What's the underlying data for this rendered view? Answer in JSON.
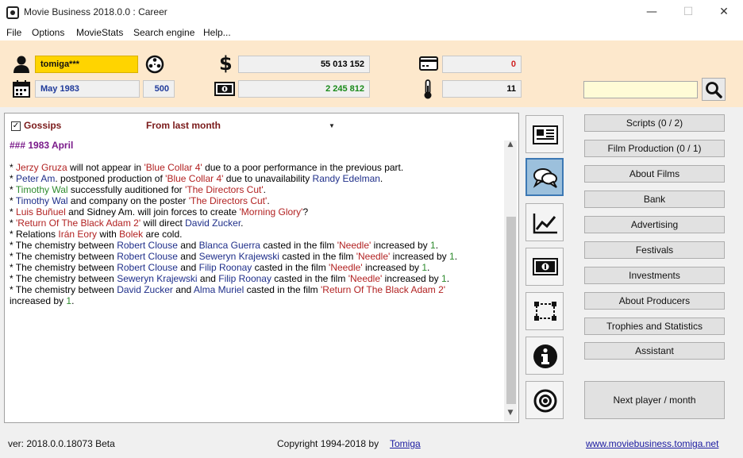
{
  "window": {
    "title": "Movie Business 2018.0.0 : Career",
    "minimize": "—",
    "maximize": "☐",
    "close": "✕"
  },
  "menu": [
    "File",
    "Options",
    "MovieStats",
    "Search engine",
    "Help..."
  ],
  "player": {
    "name": "tomiga***",
    "date": "May 1983",
    "date_number": "500",
    "money": "55 013 152",
    "cash": "2 245 812",
    "debt": "0",
    "temperature": "11",
    "search_value": ""
  },
  "colors": {
    "accent_yellow": "#ffd400",
    "panel_bg": "#fde8cc",
    "debt_red": "#d02020",
    "cash_green": "#1a8a1a"
  },
  "icons": {
    "user": "user-icon",
    "calendar": "calendar-icon",
    "film_reel": "film-reel-icon",
    "dollar": "dollar-icon",
    "banknote": "banknote-icon",
    "credit_card": "credit-card-icon",
    "thermometer": "thermometer-icon",
    "search": "search-icon"
  },
  "content": {
    "gossips_label": "Gossips",
    "period": "From last month",
    "month_heading": "### 1983 April",
    "news": [
      [
        {
          "t": "* "
        },
        {
          "t": "Jerzy Gruza",
          "c": "p"
        },
        {
          "t": " will not appear in "
        },
        {
          "t": "'Blue Collar 4'",
          "c": "f"
        },
        {
          "t": " due to a poor performance in the previous part."
        }
      ],
      [
        {
          "t": "* "
        },
        {
          "t": "Peter Am",
          "c": "n"
        },
        {
          "t": ". postponed production of "
        },
        {
          "t": "'Blue Collar 4'",
          "c": "f"
        },
        {
          "t": " due to unavailability "
        },
        {
          "t": "Randy Edelman",
          "c": "n"
        },
        {
          "t": "."
        }
      ],
      [
        {
          "t": "* "
        },
        {
          "t": "Timothy Wal",
          "c": "g"
        },
        {
          "t": " successfully auditioned for "
        },
        {
          "t": "'The Directors Cut'",
          "c": "f"
        },
        {
          "t": "."
        }
      ],
      [
        {
          "t": "* "
        },
        {
          "t": "Timothy Wal",
          "c": "n"
        },
        {
          "t": " and company on the poster "
        },
        {
          "t": "'The Directors Cut'",
          "c": "f"
        },
        {
          "t": "."
        }
      ],
      [
        {
          "t": "* "
        },
        {
          "t": "Luis Buñuel",
          "c": "p"
        },
        {
          "t": " and Sidney Am. will join forces to create "
        },
        {
          "t": "'Morning Glory'",
          "c": "f"
        },
        {
          "t": "?"
        }
      ],
      [
        {
          "t": "* "
        },
        {
          "t": "'Return Of The Black Adam 2'",
          "c": "f"
        },
        {
          "t": " will direct "
        },
        {
          "t": "David Zucker",
          "c": "n"
        },
        {
          "t": "."
        }
      ],
      [
        {
          "t": "* Relations "
        },
        {
          "t": "Irán Eory",
          "c": "p"
        },
        {
          "t": " with "
        },
        {
          "t": "Bolek",
          "c": "p"
        },
        {
          "t": " are cold."
        }
      ],
      [
        {
          "t": "* The chemistry between "
        },
        {
          "t": "Robert Clouse",
          "c": "n"
        },
        {
          "t": " and "
        },
        {
          "t": "Blanca Guerra",
          "c": "n"
        },
        {
          "t": " casted in the film "
        },
        {
          "t": "'Needle'",
          "c": "f"
        },
        {
          "t": " increased by "
        },
        {
          "t": "1",
          "c": "g"
        },
        {
          "t": "."
        }
      ],
      [
        {
          "t": "* The chemistry between "
        },
        {
          "t": "Robert Clouse",
          "c": "n"
        },
        {
          "t": " and "
        },
        {
          "t": "Seweryn Krajewski",
          "c": "n"
        },
        {
          "t": " casted in the film "
        },
        {
          "t": "'Needle'",
          "c": "f"
        },
        {
          "t": " increased by "
        },
        {
          "t": "1",
          "c": "g"
        },
        {
          "t": "."
        }
      ],
      [
        {
          "t": "* The chemistry between "
        },
        {
          "t": "Robert Clouse",
          "c": "n"
        },
        {
          "t": " and "
        },
        {
          "t": "Filip Roonay",
          "c": "n"
        },
        {
          "t": " casted in the film "
        },
        {
          "t": "'Needle'",
          "c": "f"
        },
        {
          "t": " increased by "
        },
        {
          "t": "1",
          "c": "g"
        },
        {
          "t": "."
        }
      ],
      [
        {
          "t": "* The chemistry between "
        },
        {
          "t": "Seweryn Krajewski",
          "c": "n"
        },
        {
          "t": " and "
        },
        {
          "t": "Filip Roonay",
          "c": "n"
        },
        {
          "t": " casted in the film "
        },
        {
          "t": "'Needle'",
          "c": "f"
        },
        {
          "t": " increased by "
        },
        {
          "t": "1",
          "c": "g"
        },
        {
          "t": "."
        }
      ],
      [
        {
          "t": "* The chemistry between "
        },
        {
          "t": "David Zucker",
          "c": "n"
        },
        {
          "t": " and "
        },
        {
          "t": "Alma Muriel",
          "c": "n"
        },
        {
          "t": " casted in the film "
        },
        {
          "t": "'Return Of The Black Adam 2'",
          "c": "f"
        }
      ],
      [
        {
          "t": "increased by "
        },
        {
          "t": "1",
          "c": "g"
        },
        {
          "t": "."
        }
      ]
    ]
  },
  "side_icons": [
    "newspaper-icon",
    "chat-bubbles-icon",
    "chart-icon",
    "money-icon",
    "resize-frame-icon",
    "info-icon",
    "target-icon"
  ],
  "actions": {
    "scripts": "Scripts (0 / 2)",
    "film_production": "Film Production (0 / 1)",
    "about_films": "About Films",
    "bank": "Bank",
    "advertising": "Advertising",
    "festivals": "Festivals",
    "investments": "Investments",
    "about_producers": "About Producers",
    "trophies": "Trophies and Statistics",
    "assistant": "Assistant",
    "next": "Next player / month"
  },
  "status": {
    "version": "ver: 2018.0.0.18073 Beta",
    "copyright": "Copyright 1994-2018 by",
    "author": "Tomiga",
    "website": "www.moviebusiness.tomiga.net"
  }
}
